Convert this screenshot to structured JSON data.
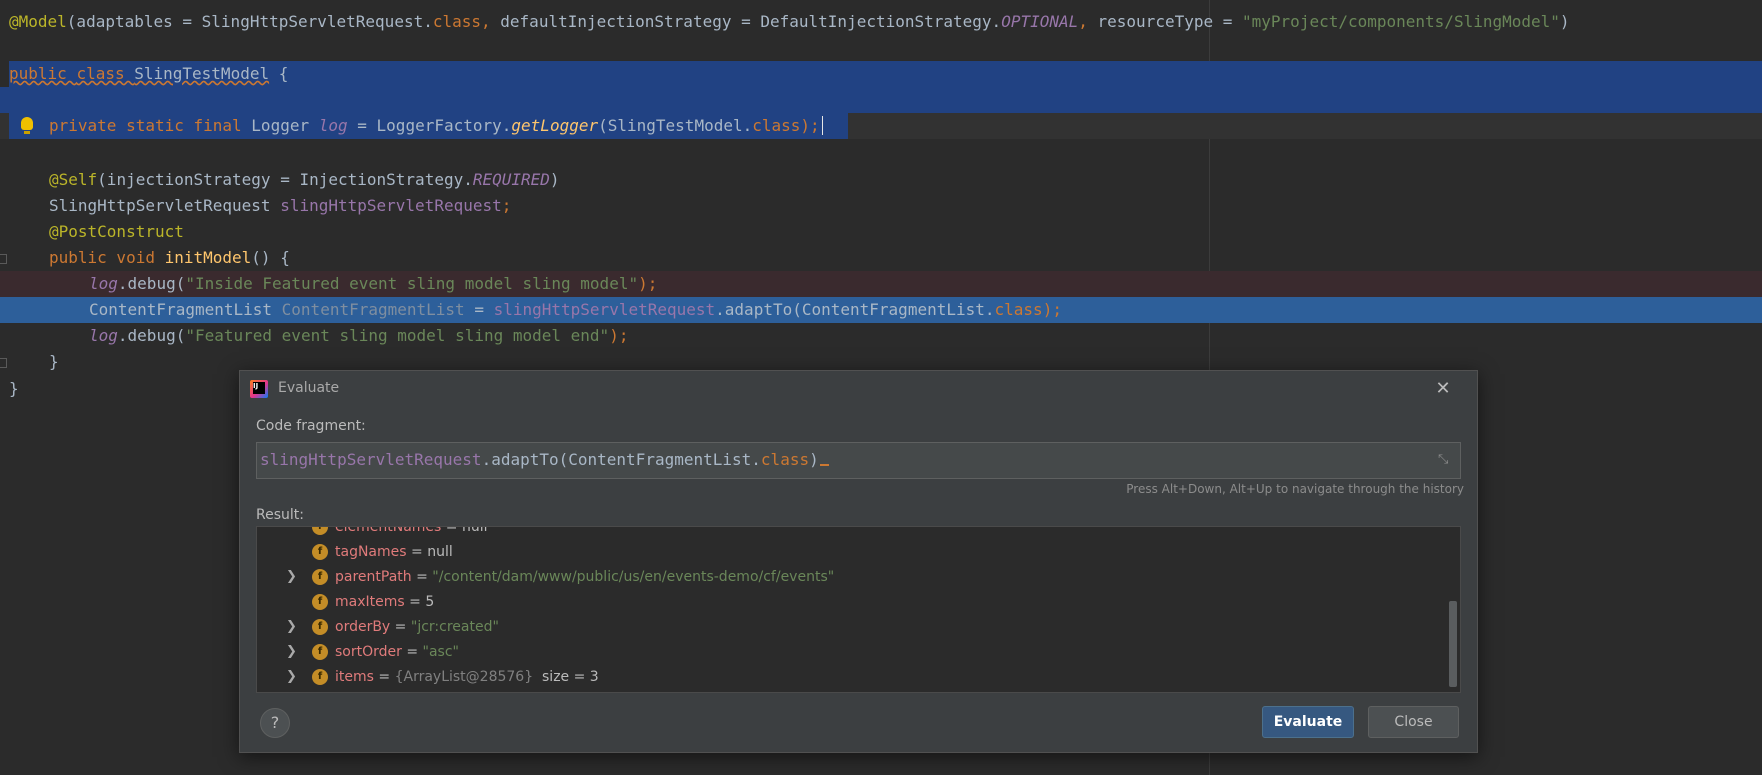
{
  "editor": {
    "lines": {
      "l1": {
        "a1": "@Model",
        "a2": "(adaptables = SlingHttpServletRequest.",
        "a3": "class",
        ",": ",",
        "a4": ", ",
        "a5": "defaultInjectionStrategy = DefaultInjectionStrategy.",
        "a6": "OPTIONAL",
        "a7": ", ",
        "a8": "resourceType = ",
        "a9": "\"myProject/components/SlingModel\"",
        "a10": ")"
      },
      "l3": {
        "k1": "public ",
        "k2": "class ",
        "c": "SlingTestModel",
        "b": " {"
      },
      "l5": {
        "k": "private static final ",
        "t": "Logger ",
        "f": "log",
        "eq": " = LoggerFactory.",
        "m": "getLogger",
        "p": "(SlingTestModel.",
        "cl": "class",
        "end": ");"
      },
      "l7": {
        "a": "@Self",
        "p": "(injectionStrategy = InjectionStrategy.",
        "f": "REQUIRED",
        "e": ")"
      },
      "l8": {
        "t": "SlingHttpServletRequest ",
        "f": "slingHttpServletRequest",
        "e": ";"
      },
      "l9": {
        "a": "@PostConstruct"
      },
      "l10": {
        "k": "public void ",
        "m": "initModel",
        "e": "() {"
      },
      "l11": {
        "f": "log",
        "d": ".debug(",
        "s": "\"Inside Featured event sling model sling model\"",
        "e": ");"
      },
      "l12": {
        "t": "ContentFragmentList ",
        "v": "ContentFragmentList",
        "eq": " = ",
        "f": "slingHttpServletRequest",
        "m": ".adaptTo(ContentFragmentList.",
        "cl": "class",
        "e": ");"
      },
      "l13": {
        "f": "log",
        "d": ".debug(",
        "s": "\"Featured event sling model sling model end\"",
        "e": ");"
      },
      "l14": {
        "b": "}"
      },
      "l15": {
        "b": "}"
      }
    }
  },
  "dialog": {
    "title": "Evaluate",
    "code_fragment_label": "Code fragment:",
    "code": {
      "field": "slingHttpServletRequest",
      "call": ".adaptTo(ContentFragmentList.",
      "cls": "class",
      "end": ")"
    },
    "hint": "Press Alt+Down, Alt+Up to navigate through the history",
    "result_label": "Result:",
    "result_rows": [
      {
        "name": "elementNames",
        "eq": " = ",
        "value": "null",
        "kind": "plain",
        "expandable": false
      },
      {
        "name": "tagNames",
        "eq": " = ",
        "value": "null",
        "kind": "plain",
        "expandable": false
      },
      {
        "name": "parentPath",
        "eq": " = ",
        "value": "\"/content/dam/www/public/us/en/events-demo/cf/events\"",
        "kind": "string",
        "expandable": true
      },
      {
        "name": "maxItems",
        "eq": " = ",
        "value": "5",
        "kind": "plain",
        "expandable": false
      },
      {
        "name": "orderBy",
        "eq": " = ",
        "value": "\"jcr:created\"",
        "kind": "string",
        "expandable": true
      },
      {
        "name": "sortOrder",
        "eq": " = ",
        "value": "\"asc\"",
        "kind": "string",
        "expandable": true
      },
      {
        "name": "items",
        "eq": " = ",
        "value": "{ArrayList@28576}",
        "extra": "  size = 3",
        "kind": "ref",
        "expandable": true
      }
    ],
    "field_badge": "f",
    "help_label": "?",
    "evaluate_label": "Evaluate",
    "close_label": "Close"
  }
}
